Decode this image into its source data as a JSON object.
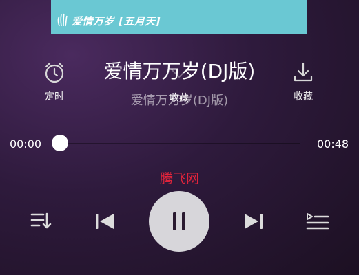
{
  "album": {
    "text": "爱情万岁 [五月天]",
    "logo_icon": "handprint-logo"
  },
  "header": {
    "timer_label": "定时",
    "collect_label": "收藏",
    "title": "爱情万万岁(DJ版)",
    "subtitle": "爱情万万岁(DJ版)",
    "overlay_fav_label": "收藏"
  },
  "progress": {
    "current_time": "00:00",
    "total_time": "00:48",
    "fraction": 0.0
  },
  "watermark": "腾飞网",
  "controls": {
    "playlist_icon": "playlist-icon",
    "prev_icon": "skip-previous-icon",
    "play_pause_icon": "pause-icon",
    "next_icon": "skip-next-icon",
    "queue_icon": "queue-list-icon"
  },
  "colors": {
    "album_strip": "#6ac8d3",
    "watermark": "#e0243b",
    "play_button": "#d7d6da"
  }
}
